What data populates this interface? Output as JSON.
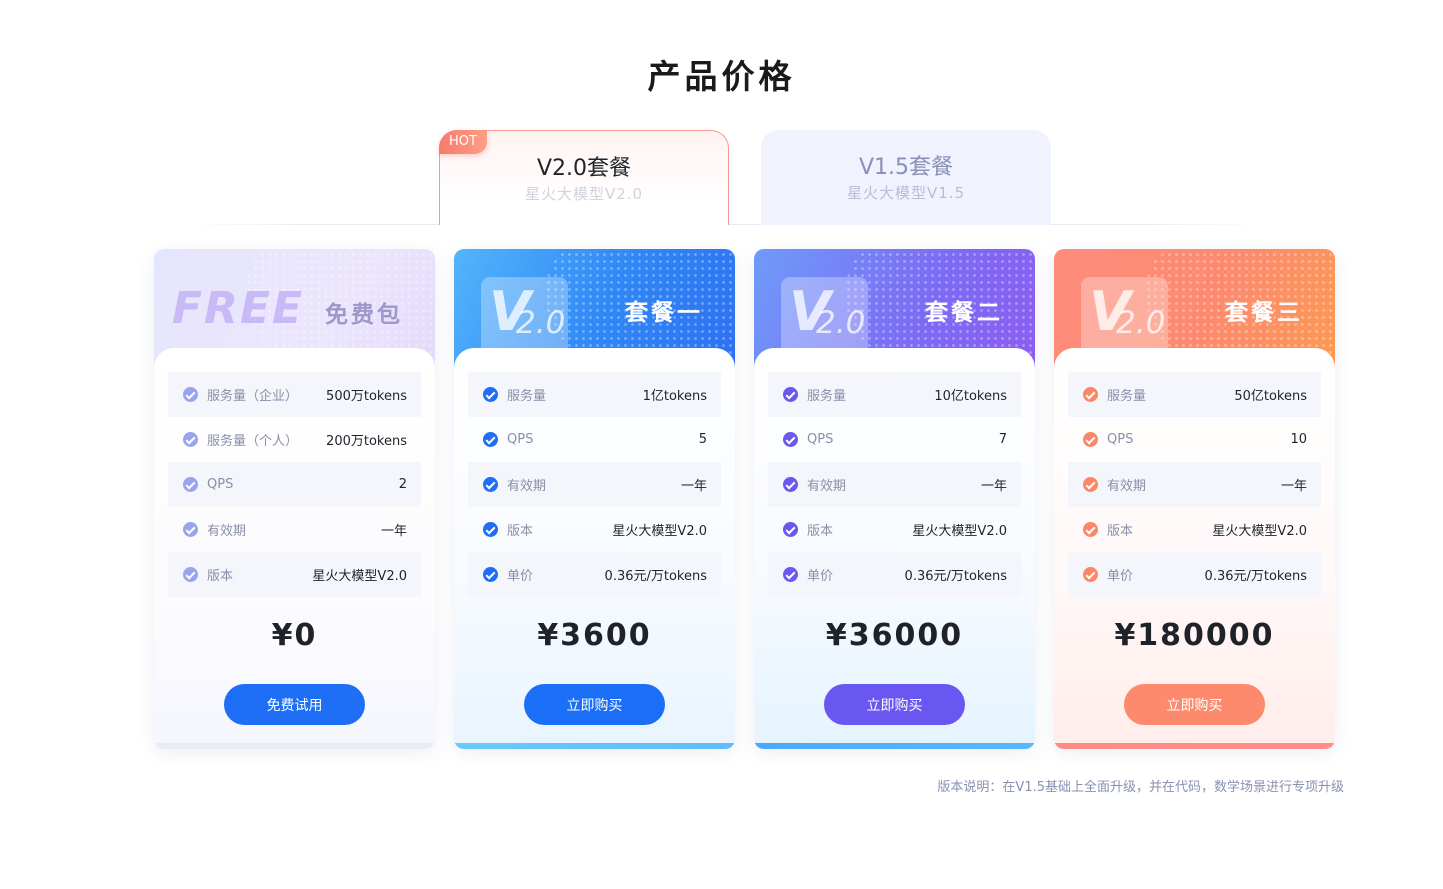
{
  "page_title": "产品价格",
  "tabs": [
    {
      "title": "V2.0套餐",
      "subtitle": "星火大模型V2.0",
      "badge": "HOT",
      "active": true
    },
    {
      "title": "V1.5套餐",
      "subtitle": "星火大模型V1.5",
      "active": false
    }
  ],
  "cards": [
    {
      "head_word": "FREE",
      "name": "免费包",
      "check_color": "#9aa4ec",
      "rows": [
        {
          "label": "服务量（企业）",
          "value": "500万tokens"
        },
        {
          "label": "服务量（个人）",
          "value": "200万tokens"
        },
        {
          "label": "QPS",
          "value": "2"
        },
        {
          "label": "有效期",
          "value": "一年"
        },
        {
          "label": "版本",
          "value": "星火大模型V2.0"
        }
      ],
      "price": "¥0",
      "button": "免费试用",
      "button_color": "#1e6ff6"
    },
    {
      "logo": {
        "letter": "V",
        "num": "2.0",
        "icon": "v2-logo-icon"
      },
      "name": "套餐一",
      "check_color": "#1f6ef5",
      "rows": [
        {
          "label": "服务量",
          "value": "1亿tokens"
        },
        {
          "label": "QPS",
          "value": "5"
        },
        {
          "label": "有效期",
          "value": "一年"
        },
        {
          "label": "版本",
          "value": "星火大模型V2.0"
        },
        {
          "label": "单价",
          "value": "0.36元/万tokens"
        }
      ],
      "price": "¥3600",
      "button": "立即购买",
      "button_color": "#1a6ff6"
    },
    {
      "logo": {
        "letter": "V",
        "num": "2.0",
        "icon": "v2-logo-icon"
      },
      "name": "套餐二",
      "check_color": "#6a58ef",
      "rows": [
        {
          "label": "服务量",
          "value": "10亿tokens"
        },
        {
          "label": "QPS",
          "value": "7"
        },
        {
          "label": "有效期",
          "value": "一年"
        },
        {
          "label": "版本",
          "value": "星火大模型V2.0"
        },
        {
          "label": "单价",
          "value": "0.36元/万tokens"
        }
      ],
      "price": "¥36000",
      "button": "立即购买",
      "button_color": "#6a56f1"
    },
    {
      "logo": {
        "letter": "V",
        "num": "2.0",
        "icon": "v2-logo-icon"
      },
      "name": "套餐三",
      "check_color": "#fc8768",
      "rows": [
        {
          "label": "服务量",
          "value": "50亿tokens"
        },
        {
          "label": "QPS",
          "value": "10"
        },
        {
          "label": "有效期",
          "value": "一年"
        },
        {
          "label": "版本",
          "value": "星火大模型V2.0"
        },
        {
          "label": "单价",
          "value": "0.36元/万tokens"
        }
      ],
      "price": "¥180000",
      "button": "立即购买",
      "button_color": "#fd8a6d"
    }
  ],
  "footnote": "版本说明：在V1.5基础上全面升级，并在代码，数学场景进行专项升级"
}
